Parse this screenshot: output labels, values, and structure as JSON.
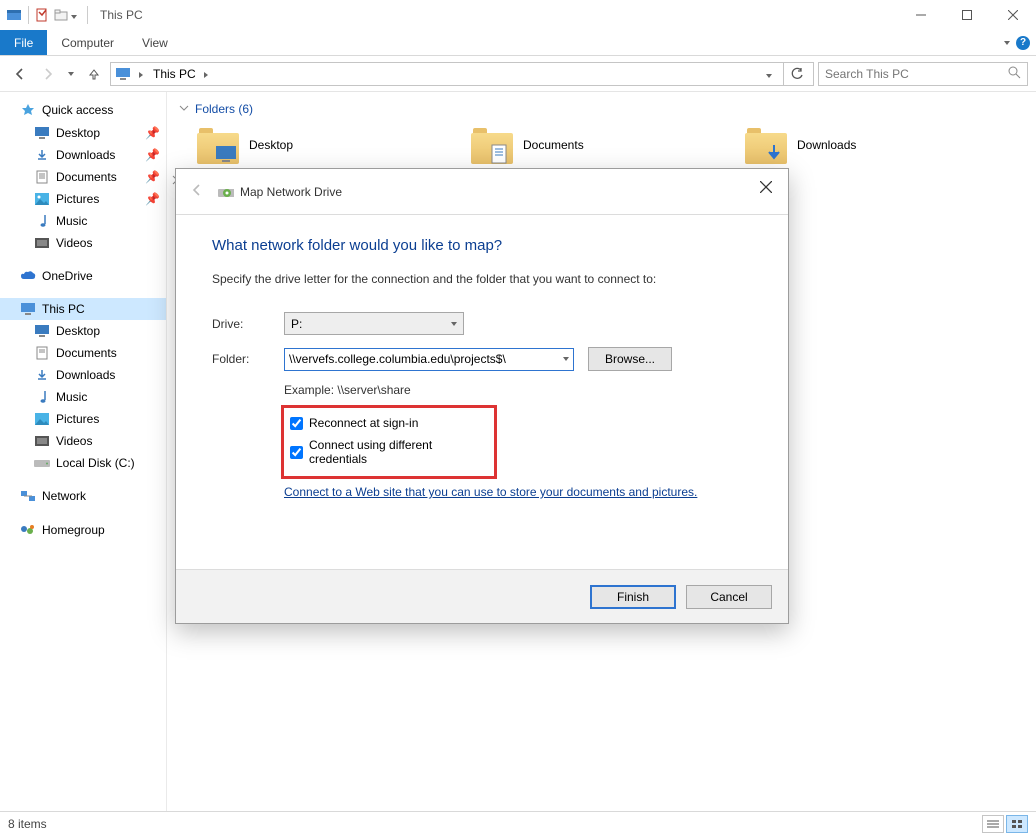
{
  "window": {
    "title": "This PC"
  },
  "ribbon": {
    "file": "File",
    "tabs": [
      "Computer",
      "View"
    ]
  },
  "address": {
    "location": "This PC",
    "search_placeholder": "Search This PC"
  },
  "tree": {
    "quick_access": {
      "label": "Quick access",
      "items": [
        {
          "label": "Desktop",
          "pinned": true
        },
        {
          "label": "Downloads",
          "pinned": true
        },
        {
          "label": "Documents",
          "pinned": true
        },
        {
          "label": "Pictures",
          "pinned": true
        },
        {
          "label": "Music",
          "pinned": false
        },
        {
          "label": "Videos",
          "pinned": false
        }
      ]
    },
    "onedrive": {
      "label": "OneDrive"
    },
    "this_pc": {
      "label": "This PC",
      "items": [
        {
          "label": "Desktop"
        },
        {
          "label": "Documents"
        },
        {
          "label": "Downloads"
        },
        {
          "label": "Music"
        },
        {
          "label": "Pictures"
        },
        {
          "label": "Videos"
        },
        {
          "label": "Local Disk (C:)"
        }
      ]
    },
    "network": {
      "label": "Network"
    },
    "homegroup": {
      "label": "Homegroup"
    }
  },
  "content": {
    "folders_header": "Folders (6)",
    "folders": [
      "Desktop",
      "Documents",
      "Downloads"
    ]
  },
  "statusbar": {
    "items": "8 items"
  },
  "dialog": {
    "title": "Map Network Drive",
    "heading": "What network folder would you like to map?",
    "instruction": "Specify the drive letter for the connection and the folder that you want to connect to:",
    "drive_label": "Drive:",
    "drive_value": "P:",
    "folder_label": "Folder:",
    "folder_value": "\\\\vervefs.college.columbia.edu\\projects$\\",
    "browse": "Browse...",
    "example": "Example: \\\\server\\share",
    "reconnect": "Reconnect at sign-in",
    "diffcreds": "Connect using different credentials",
    "link_text": "Connect to a Web site that you can use to store your documents and pictures",
    "finish": "Finish",
    "cancel": "Cancel"
  }
}
